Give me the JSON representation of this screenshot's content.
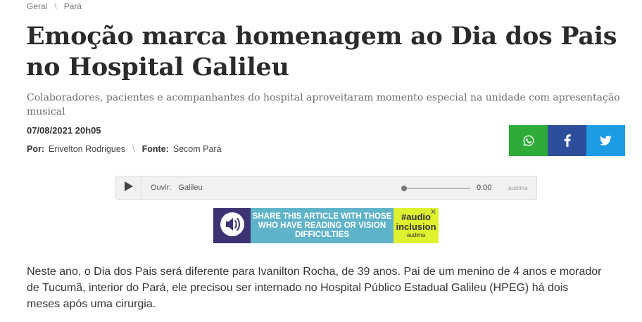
{
  "breadcrumb": {
    "items": [
      "Geral",
      "Pará"
    ],
    "separator": "\\"
  },
  "article": {
    "title": "Emoção marca homenagem ao Dia dos Pais no Hospital Galileu",
    "subtitle": "Colaboradores, pacientes e acompanhantes do hospital aproveitaram momento especial na unidade com apresentação musical",
    "date": "07/08/2021 20h05",
    "author_label": "Por:",
    "author": "Erivelton Rodrigues",
    "source_label": "Fonte:",
    "source": "Secom Pará",
    "body": "Neste ano, o Dia dos Pais será diferente para Ivanilton Rocha, de 39 anos. Pai de um menino de 4 anos e morador de Tucumã, interior do Pará, ele precisou ser internado no Hospital Público Estadual Galileu (HPEG) há dois meses após uma cirurgia."
  },
  "share": {
    "buttons": [
      {
        "icon": "whatsapp-icon",
        "color": "#2fab3a"
      },
      {
        "icon": "facebook-icon",
        "color": "#2d4f9b"
      },
      {
        "icon": "twitter-icon",
        "color": "#1c9ce5"
      }
    ]
  },
  "player": {
    "listen_label": "Ouvir:",
    "track": "Galileu",
    "time": "0:00",
    "brand": "audima",
    "progress": 0
  },
  "banner": {
    "message": "SHARE THIS ARTICLE WITH THOSE WHO HAVE READING OR VISION DIFFICULTIES",
    "tag_line1": "#audio",
    "tag_line2": "inclusion",
    "tag_brand": "audima",
    "close": "✕",
    "colors": {
      "icon_bg": "#3d3272",
      "text_bg": "#5fb3c8",
      "tag_bg": "#dff12f"
    }
  }
}
